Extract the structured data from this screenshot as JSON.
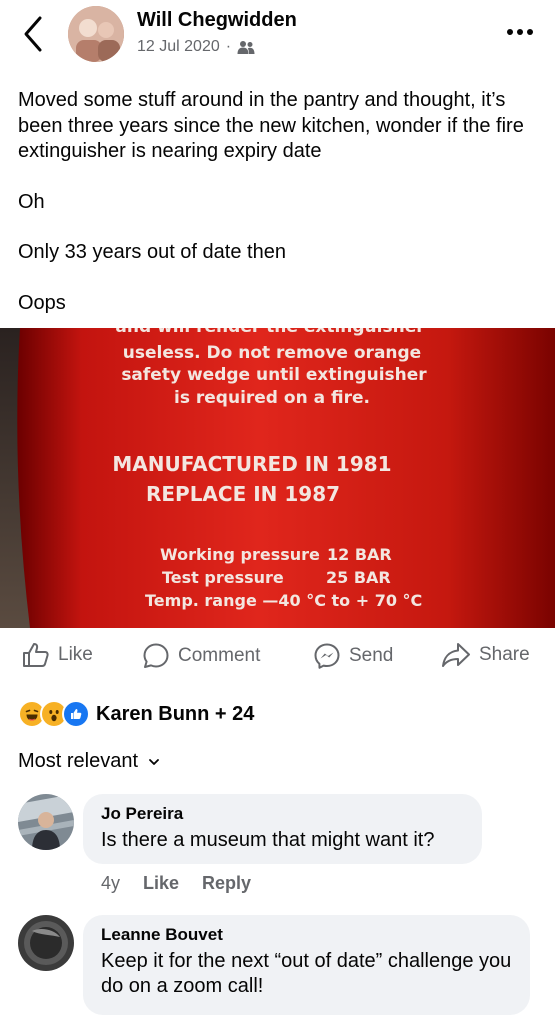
{
  "post": {
    "author": "Will Chegwidden",
    "date": "12 Jul 2020",
    "separator": "·",
    "audience_icon": "friends-icon",
    "more_icon": "more-icon",
    "text": [
      "Moved some stuff around in the pantry and thought, it’s been three years since the new kitchen, wonder if the fire extinguisher is nearing expiry date",
      "Oh",
      "Only 33 years out of date then",
      "Oops"
    ]
  },
  "photo": {
    "lines_top": [
      "and will render the extinguisher",
      "useless. Do not remove orange",
      "safety wedge until extinguisher",
      "is required on a fire."
    ],
    "manufactured": "MANUFACTURED IN 1981",
    "replace": "REPLACE IN 1987",
    "working_label": "Working pressure",
    "working_value": "12 BAR",
    "test_label": "Test pressure",
    "test_value": "25 BAR",
    "temp": "Temp. range —40 °C to + 70 °C"
  },
  "actions": {
    "like": "Like",
    "comment": "Comment",
    "send": "Send",
    "share": "Share"
  },
  "reactions": {
    "icons": [
      "haha-icon",
      "wow-icon",
      "like-reaction-icon"
    ],
    "summary": "Karen Bunn + 24",
    "colors": {
      "like": "#1877f2",
      "emoji": "#f7b125"
    }
  },
  "sort": {
    "label": "Most relevant"
  },
  "comments": [
    {
      "author": "Jo Pereira",
      "text": "Is there a museum that might want it?",
      "age": "4y",
      "like": "Like",
      "reply": "Reply"
    },
    {
      "author": "Leanne Bouvet",
      "text": "Keep it for the next “out of date” challenge you do on a zoom call!"
    }
  ]
}
